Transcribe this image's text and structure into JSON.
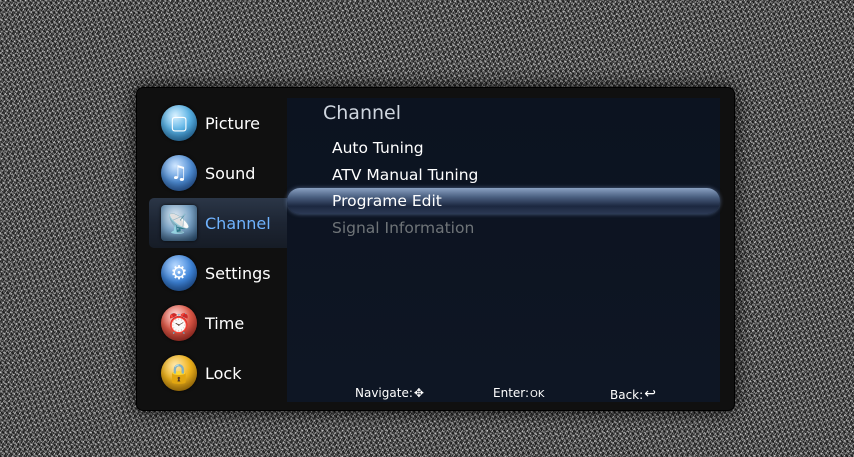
{
  "menu": {
    "sidebar": [
      {
        "label": "Picture",
        "icon": "picture-icon",
        "glyph": "▢"
      },
      {
        "label": "Sound",
        "icon": "sound-icon",
        "glyph": "♫"
      },
      {
        "label": "Channel",
        "icon": "satellite-dish-icon",
        "glyph": "📡"
      },
      {
        "label": "Settings",
        "icon": "gears-icon",
        "glyph": "⚙"
      },
      {
        "label": "Time",
        "icon": "alarm-clock-icon",
        "glyph": "⏰"
      },
      {
        "label": "Lock",
        "icon": "padlock-icon",
        "glyph": "🔒"
      }
    ],
    "active": "Channel"
  },
  "panel": {
    "title": "Channel",
    "items": [
      {
        "label": "Auto Tuning",
        "state": "normal"
      },
      {
        "label": "ATV Manual Tuning",
        "state": "normal"
      },
      {
        "label": "Programe Edit",
        "state": "highlighted"
      },
      {
        "label": "Signal Information",
        "state": "disabled"
      }
    ]
  },
  "footer": {
    "navigate": "Navigate:",
    "navigate_glyph": "✥",
    "enter": "Enter:",
    "enter_glyph": "OK",
    "back": "Back:",
    "back_glyph": "↩"
  }
}
